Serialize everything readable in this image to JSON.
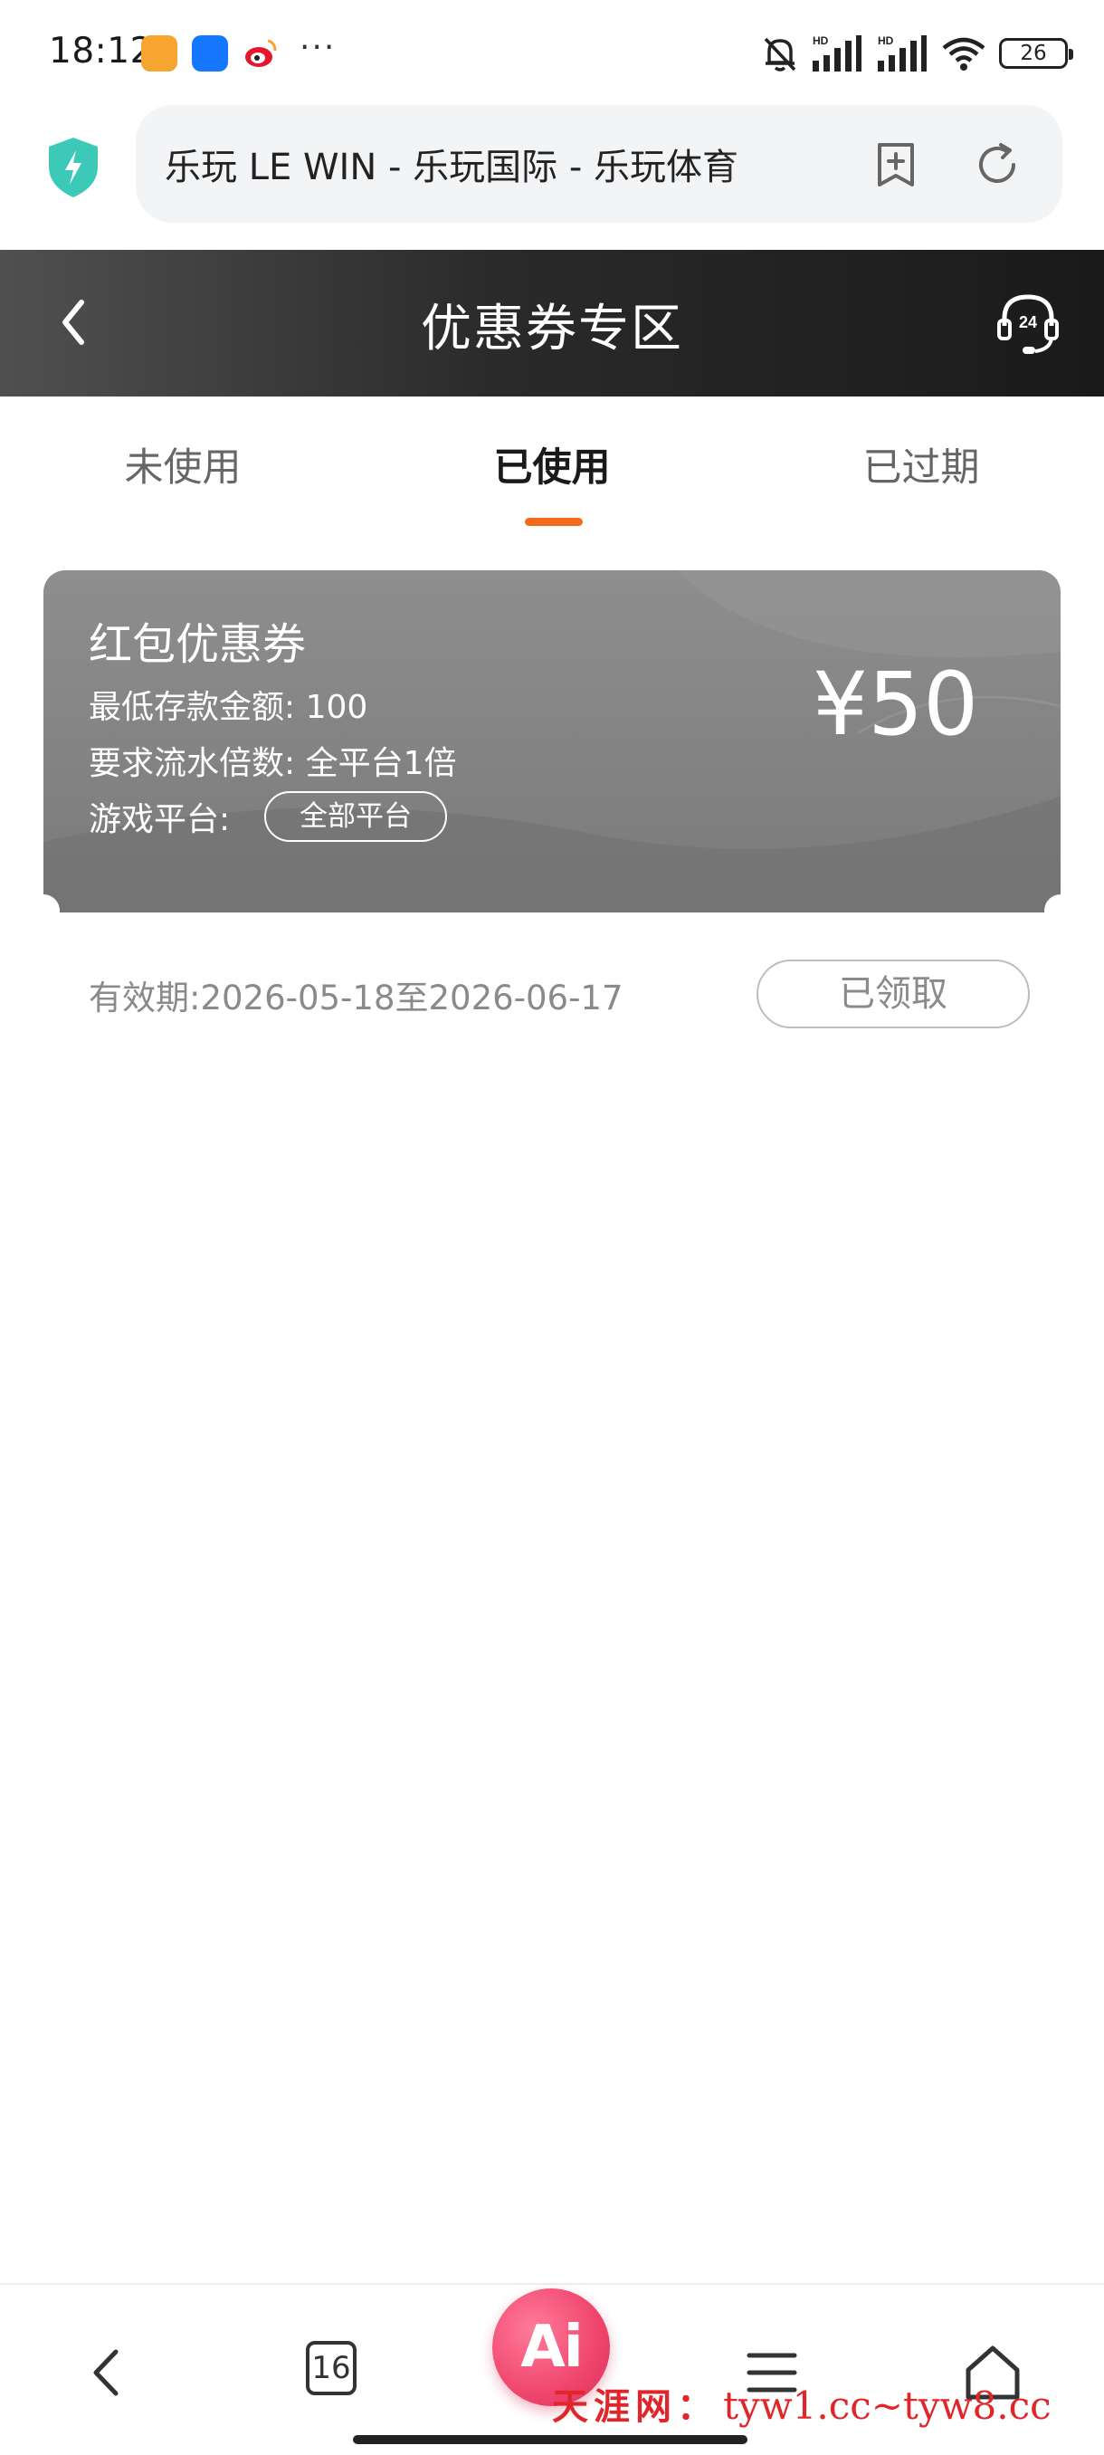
{
  "status_bar": {
    "time": "18:12",
    "more": "···",
    "battery": "26",
    "signal_label_1": "HD",
    "signal_label_2": "HD"
  },
  "browser": {
    "address": "乐玩 LE WIN - 乐玩国际 - 乐玩体育",
    "shield_color": "#3cc9b8"
  },
  "header": {
    "title": "优惠券专区",
    "support_label": "24"
  },
  "tabs": [
    {
      "label": "未使用",
      "active": false
    },
    {
      "label": "已使用",
      "active": true
    },
    {
      "label": "已过期",
      "active": false
    }
  ],
  "coupon": {
    "title": "红包优惠券",
    "min_deposit": "最低存款金额: 100",
    "turnover": "要求流水倍数: 全平台1倍",
    "platform_label": "游戏平台:",
    "platform_value": "全部平台",
    "amount": "¥50",
    "validity": "有效期:2026-05-18至2026-06-17",
    "status_button": "已领取"
  },
  "bottom_nav": {
    "tabs_count": "16",
    "ai_label": "Ai"
  },
  "watermark": {
    "chinese": "天涯网：",
    "url": "tyw1.cc~tyw8.cc"
  },
  "colors": {
    "accent": "#f26b1d",
    "coupon_bg": "#858585",
    "header_bg": "#1a1a1a",
    "watermark": "#e0262b"
  }
}
